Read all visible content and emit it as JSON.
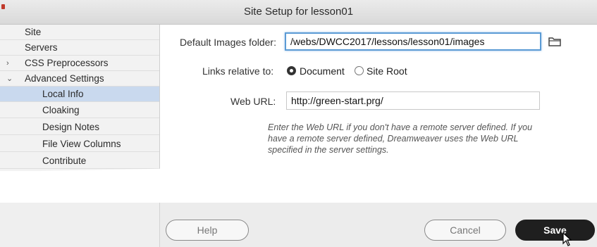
{
  "window": {
    "title": "Site Setup for lesson01"
  },
  "sidebar": {
    "items": [
      {
        "label": "Site",
        "indent": 0,
        "chevron": ""
      },
      {
        "label": "Servers",
        "indent": 0,
        "chevron": ""
      },
      {
        "label": "CSS Preprocessors",
        "indent": 0,
        "chevron": "›"
      },
      {
        "label": "Advanced Settings",
        "indent": 0,
        "chevron": "⌄"
      },
      {
        "label": "Local Info",
        "indent": 1,
        "chevron": "",
        "selected": true
      },
      {
        "label": "Cloaking",
        "indent": 1,
        "chevron": ""
      },
      {
        "label": "Design Notes",
        "indent": 1,
        "chevron": ""
      },
      {
        "label": "File View Columns",
        "indent": 1,
        "chevron": ""
      },
      {
        "label": "Contribute",
        "indent": 1,
        "chevron": ""
      }
    ]
  },
  "form": {
    "images_folder_label": "Default Images folder:",
    "images_folder_value": "/webs/DWCC2017/lessons/lesson01/images",
    "links_relative_label": "Links relative to:",
    "radio_document_label": "Document",
    "radio_site_root_label": "Site Root",
    "selected_radio": "Document",
    "web_url_label": "Web URL:",
    "web_url_value": "http://green-start.prg/",
    "hint_line1": "Enter the Web URL if you don't have a remote server defined. If you",
    "hint_line2": "have a remote server defined, Dreamweaver uses the Web URL",
    "hint_line3": "specified in the server settings."
  },
  "footer": {
    "help_label": "Help",
    "cancel_label": "Cancel",
    "save_label": "Save"
  },
  "icons": {
    "folder": "folder-icon",
    "cursor": "pointer-cursor-icon"
  },
  "colors": {
    "selection": "#c9d9ee",
    "focus": "#5b9bd5",
    "primary_button": "#1f1f1f"
  }
}
